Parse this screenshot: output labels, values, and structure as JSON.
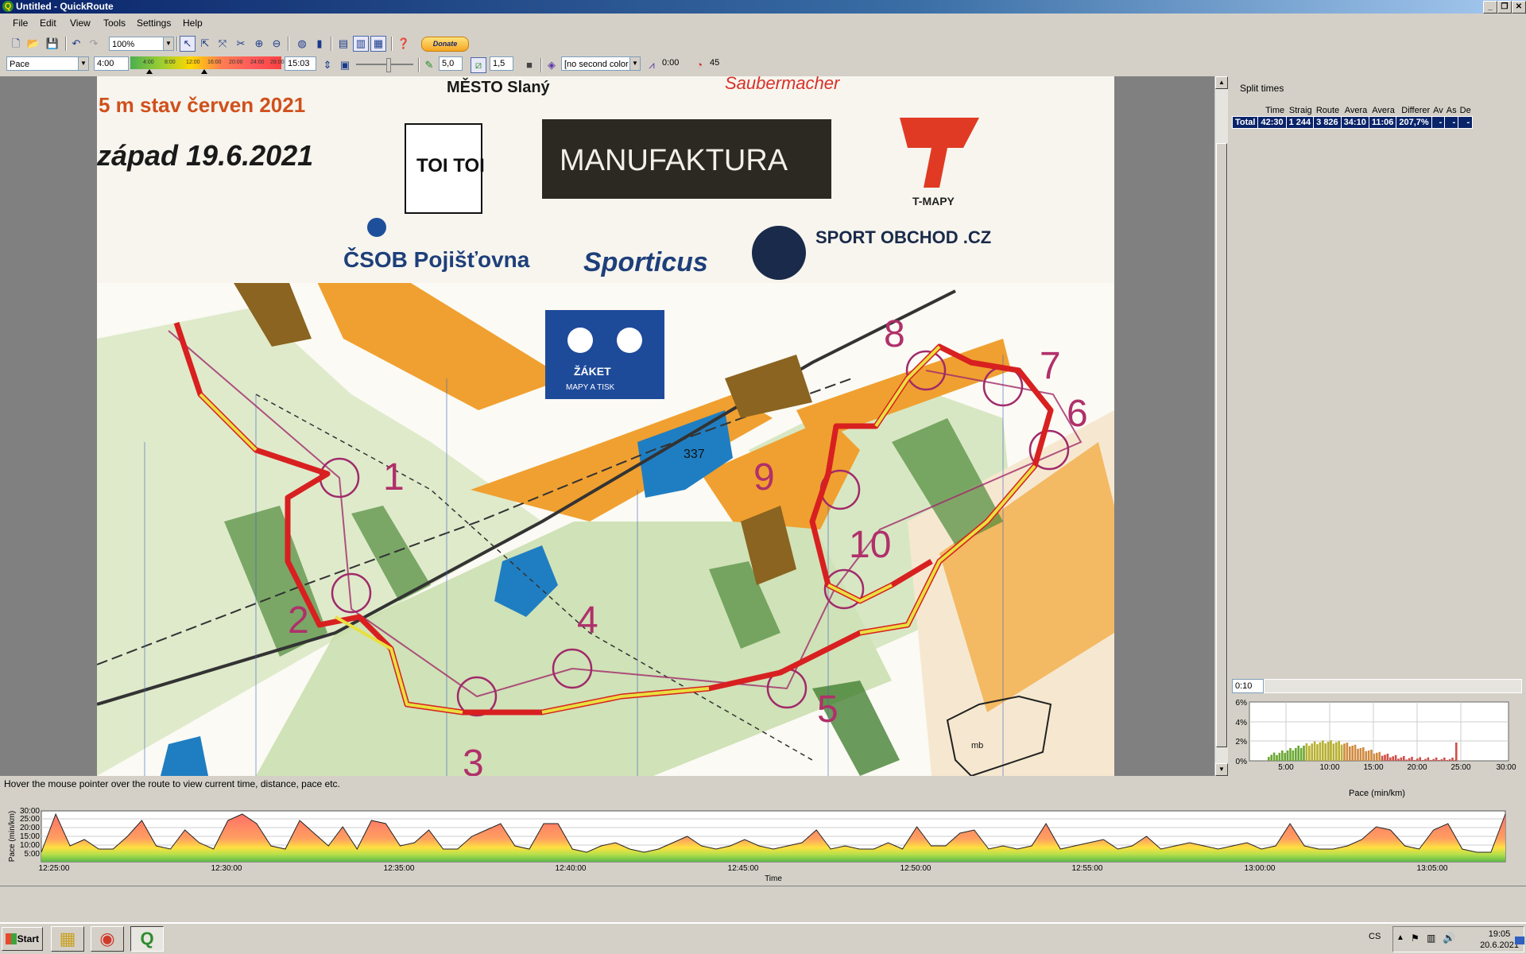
{
  "window": {
    "title": "Untitled - QuickRoute",
    "minimize": "_",
    "restore": "❐",
    "close": "✕"
  },
  "menu": [
    "File",
    "Edit",
    "View",
    "Tools",
    "Settings",
    "Help"
  ],
  "toolbar": {
    "zoom": "100%",
    "donate_label": "Donate",
    "color_coding_attribute": "Pace",
    "color_range_start": "4:00",
    "color_range_end": "15:03",
    "color_scale_ticks": [
      "4:00",
      "8:00",
      "12:00",
      "16:00",
      "20:00",
      "24:00",
      "28:00"
    ],
    "route_line_width": "5,0",
    "mask_width": "1,5",
    "second_color": "[no second color",
    "smoothing": "0:00",
    "circle_time_radius": "45"
  },
  "map": {
    "headline_date": "západ  19.6.2021",
    "headline_state": "5 m   stav červen 2021",
    "city_text": "MĚSTO Slaný",
    "sponsor_sauber": "Saubermacher",
    "sponsor_toitoi": "TOI TOI",
    "sponsor_manufaktura": "MANUFAKTURA",
    "sponsor_tmapy": "T-MAPY",
    "sponsor_csob": "ČSOB Pojišťovna",
    "sponsor_sporticus": "Sporticus",
    "sponsor_sportobchod": "SPORT OBCHOD .CZ",
    "sponsor_zaket_line1": "ŽÁKET",
    "sponsor_zaket_line2": "MAPY A TISK",
    "elevation_label": "337",
    "legend_mark": "mb",
    "control_numbers": [
      "1",
      "2",
      "3",
      "4",
      "5",
      "6",
      "7",
      "8",
      "9",
      "10"
    ]
  },
  "split_times": {
    "title": "Split times",
    "headers": [
      "",
      "Time",
      "Straig",
      "Route",
      "Avera",
      "Avera",
      "Differer",
      "Av",
      "As",
      "De"
    ],
    "total_row": [
      "Total",
      "42:30",
      "1 244",
      "3 826",
      "34:10",
      "11:06",
      "207,7%",
      "-",
      "-",
      "-"
    ]
  },
  "histogram": {
    "bin_width": "0:10",
    "y_ticks": [
      "6%",
      "4%",
      "2%",
      "0%"
    ],
    "x_ticks": [
      "5:00",
      "10:00",
      "15:00",
      "20:00",
      "25:00",
      "30:00"
    ],
    "x_label": "Pace (min/km)"
  },
  "status_text": "Hover the mouse pointer over the route to view current time, distance, pace etc.",
  "line_graph": {
    "y_label": "Pace (min/km)",
    "y_ticks": [
      "30:00",
      "25:00",
      "20:00",
      "15:00",
      "10:00",
      "5:00"
    ],
    "x_ticks": [
      "12:25:00",
      "12:30:00",
      "12:35:00",
      "12:40:00",
      "12:45:00",
      "12:50:00",
      "12:55:00",
      "13:00:00",
      "13:05:00"
    ],
    "x_label": "Time"
  },
  "taskbar": {
    "start_label": "Start",
    "language": "CS",
    "time": "19:05",
    "date": "20.6.2021"
  }
}
